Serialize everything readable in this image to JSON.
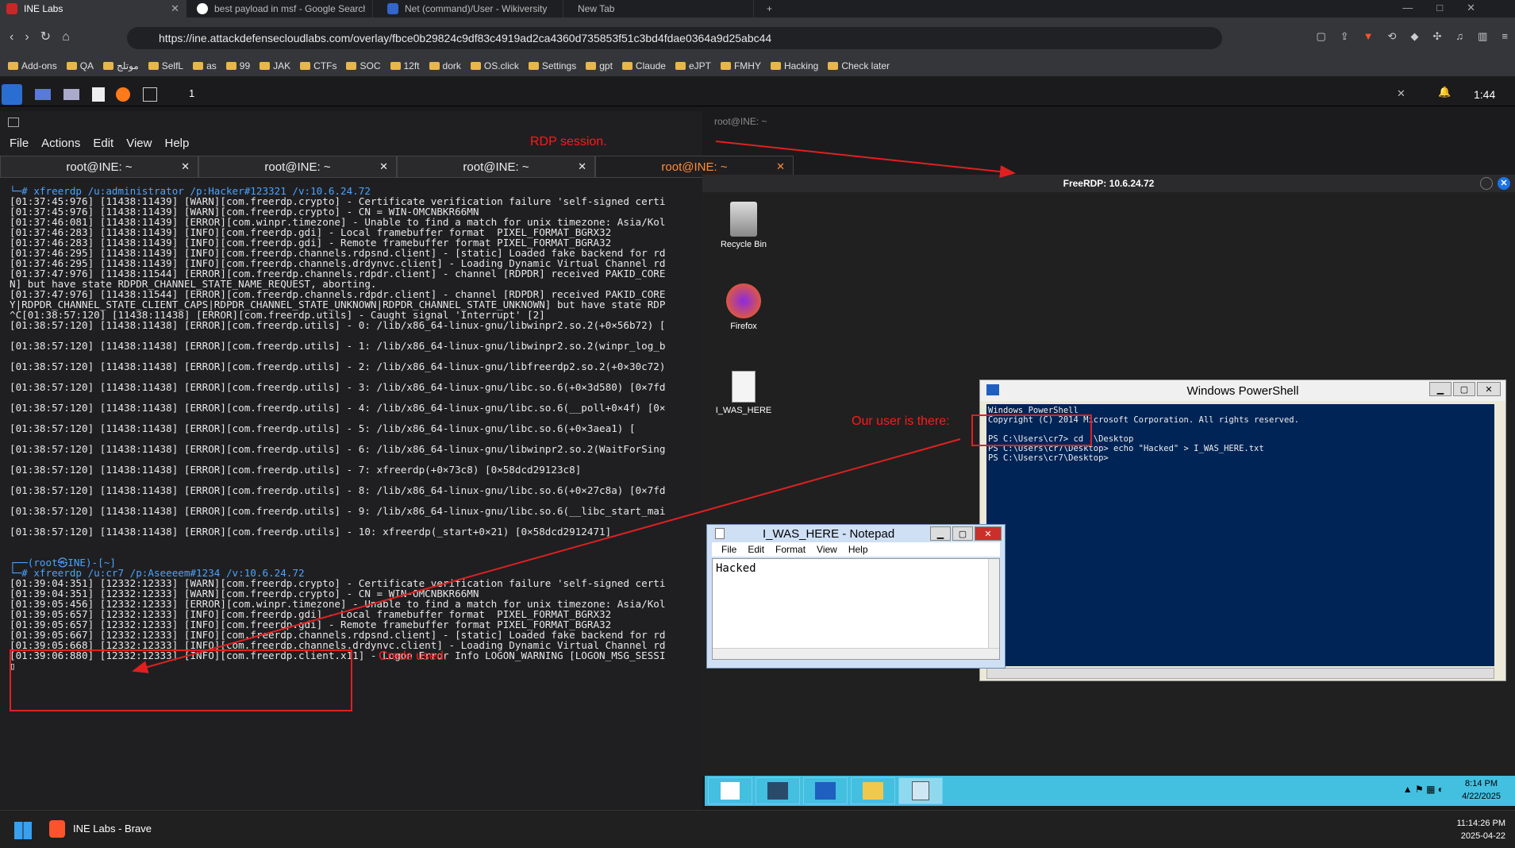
{
  "browser": {
    "tabs": [
      {
        "title": "INE Labs",
        "active": true
      },
      {
        "title": "best payload in msf - Google Search",
        "active": false
      },
      {
        "title": "Net (command)/User - Wikiversity",
        "active": false
      },
      {
        "title": "New Tab",
        "active": false
      }
    ],
    "url": "https://ine.attackdefensecloudlabs.com/overlay/fbce0b29824c9df83c4919ad2ca4360d735853f51c3bd4fdae0364a9d25abc44",
    "bookmarks": [
      "Add-ons",
      "QA",
      "موتلج",
      "SelfL",
      "as",
      "99",
      "JAK",
      "CTFs",
      "SOC",
      "12ft",
      "dork",
      "OS.click",
      "Settings",
      "gpt",
      "Claude",
      "eJPT",
      "FMHY",
      "Hacking",
      "Check later"
    ]
  },
  "kali": {
    "clock": "1:44",
    "workspace": "1",
    "window_title": "root@INE: ~",
    "menu": [
      "File",
      "Actions",
      "Edit",
      "View",
      "Help"
    ],
    "terminal_tabs": [
      "root@INE: ~",
      "root@INE: ~",
      "root@INE: ~",
      "root@INE: ~"
    ]
  },
  "terminal": {
    "lines": [
      "└─# xfreerdp /u:administrator /p:Hacker#123321 /v:10.6.24.72",
      "[01:37:45:976] [11438:11439] [WARN][com.freerdp.crypto] - Certificate verification failure 'self-signed certi",
      "[01:37:45:976] [11438:11439] [WARN][com.freerdp.crypto] - CN = WIN-OMCNBKR66MN",
      "[01:37:46:081] [11438:11439] [ERROR][com.winpr.timezone] - Unable to find a match for unix timezone: Asia/Kol",
      "[01:37:46:283] [11438:11439] [INFO][com.freerdp.gdi] - Local framebuffer format  PIXEL_FORMAT_BGRX32",
      "[01:37:46:283] [11438:11439] [INFO][com.freerdp.gdi] - Remote framebuffer format PIXEL_FORMAT_BGRA32",
      "[01:37:46:295] [11438:11439] [INFO][com.freerdp.channels.rdpsnd.client] - [static] Loaded fake backend for rd",
      "[01:37:46:295] [11438:11439] [INFO][com.freerdp.channels.drdynvc.client] - Loading Dynamic Virtual Channel rd",
      "[01:37:47:976] [11438:11544] [ERROR][com.freerdp.channels.rdpdr.client] - channel [RDPDR] received PAKID_CORE",
      "N] but have state RDPDR_CHANNEL_STATE_NAME_REQUEST, aborting.",
      "[01:37:47:976] [11438:11544] [ERROR][com.freerdp.channels.rdpdr.client] - channel [RDPDR] received PAKID_CORE",
      "Y|RDPDR_CHANNEL_STATE_CLIENT_CAPS|RDPDR_CHANNEL_STATE_UNKNOWN|RDPDR_CHANNEL_STATE_UNKNOWN] but have state RDP",
      "^C[01:38:57:120] [11438:11438] [ERROR][com.freerdp.utils] - Caught signal 'Interrupt' [2]",
      "[01:38:57:120] [11438:11438] [ERROR][com.freerdp.utils] - 0: /lib/x86_64-linux-gnu/libwinpr2.so.2(+0×56b72) [",
      "",
      "[01:38:57:120] [11438:11438] [ERROR][com.freerdp.utils] - 1: /lib/x86_64-linux-gnu/libwinpr2.so.2(winpr_log_b",
      "",
      "[01:38:57:120] [11438:11438] [ERROR][com.freerdp.utils] - 2: /lib/x86_64-linux-gnu/libfreerdp2.so.2(+0×30c72)",
      "",
      "[01:38:57:120] [11438:11438] [ERROR][com.freerdp.utils] - 3: /lib/x86_64-linux-gnu/libc.so.6(+0×3d580) [0×7fd",
      "",
      "[01:38:57:120] [11438:11438] [ERROR][com.freerdp.utils] - 4: /lib/x86_64-linux-gnu/libc.so.6(__poll+0×4f) [0×",
      "",
      "[01:38:57:120] [11438:11438] [ERROR][com.freerdp.utils] - 5: /lib/x86_64-linux-gnu/libc.so.6(+0×3aea1) [",
      "",
      "[01:38:57:120] [11438:11438] [ERROR][com.freerdp.utils] - 6: /lib/x86_64-linux-gnu/libwinpr2.so.2(WaitForSing",
      "",
      "[01:38:57:120] [11438:11438] [ERROR][com.freerdp.utils] - 7: xfreerdp(+0×73c8) [0×58dcd29123c8]",
      "",
      "[01:38:57:120] [11438:11438] [ERROR][com.freerdp.utils] - 8: /lib/x86_64-linux-gnu/libc.so.6(+0×27c8a) [0×7fd",
      "",
      "[01:38:57:120] [11438:11438] [ERROR][com.freerdp.utils] - 9: /lib/x86_64-linux-gnu/libc.so.6(__libc_start_mai",
      "",
      "[01:38:57:120] [11438:11438] [ERROR][com.freerdp.utils] - 10: xfreerdp(_start+0×21) [0×58dcd2912471]",
      "",
      "",
      "┌──(root㉿INE)-[~]",
      "└─# xfreerdp /u:cr7 /p:Aseeeem#1234 /v:10.6.24.72",
      "[01:39:04:351] [12332:12333] [WARN][com.freerdp.crypto] - Certificate verification failure 'self-signed certi",
      "[01:39:04:351] [12332:12333] [WARN][com.freerdp.crypto] - CN = WIN-OMCNBKR66MN",
      "[01:39:05:456] [12332:12333] [ERROR][com.winpr.timezone] - Unable to find a match for unix timezone: Asia/Kol",
      "[01:39:05:657] [12332:12333] [INFO][com.freerdp.gdi] - Local framebuffer format  PIXEL_FORMAT_BGRX32",
      "[01:39:05:657] [12332:12333] [INFO][com.freerdp.gdi] - Remote framebuffer format PIXEL_FORMAT_BGRA32",
      "[01:39:05:667] [12332:12333] [INFO][com.freerdp.channels.rdpsnd.client] - [static] Loaded fake backend for rd",
      "[01:39:05:668] [12332:12333] [INFO][com.freerdp.channels.drdynvc.client] - Loading Dynamic Virtual Channel rd",
      "[01:39:06:880] [12332:12333] [INFO][com.freerdp.client.x11] - Logon Error Info LOGON_WARNING [LOGON_MSG_SESSI",
      "▯"
    ]
  },
  "rdp": {
    "title": "FreeRDP: 10.6.24.72",
    "desktop_icons": [
      "Recycle Bin",
      "Firefox",
      "I_WAS_HERE"
    ],
    "powershell": {
      "title": "Windows PowerShell",
      "lines": [
        "Windows PowerShell",
        "Copyright (C) 2014 Microsoft Corporation. All rights reserved.",
        "",
        "PS C:\\Users\\cr7> cd .\\Desktop",
        "PS C:\\Users\\cr7\\Desktop> echo \"Hacked\" > I_WAS_HERE.txt",
        "PS C:\\Users\\cr7\\Desktop>"
      ]
    },
    "notepad": {
      "title": "I_WAS_HERE - Notepad",
      "menu": [
        "File",
        "Edit",
        "Format",
        "View",
        "Help"
      ],
      "content": "Hacked"
    },
    "taskbar_time": "8:14 PM",
    "taskbar_date": "4/22/2025"
  },
  "host_taskbar": {
    "app": "INE Labs - Brave",
    "time": "11:14:26 PM",
    "date": "2025-04-22"
  },
  "annotations": {
    "rdp": "RDP session.",
    "user": "Our user is there:",
    "creds": "Creds used:"
  }
}
